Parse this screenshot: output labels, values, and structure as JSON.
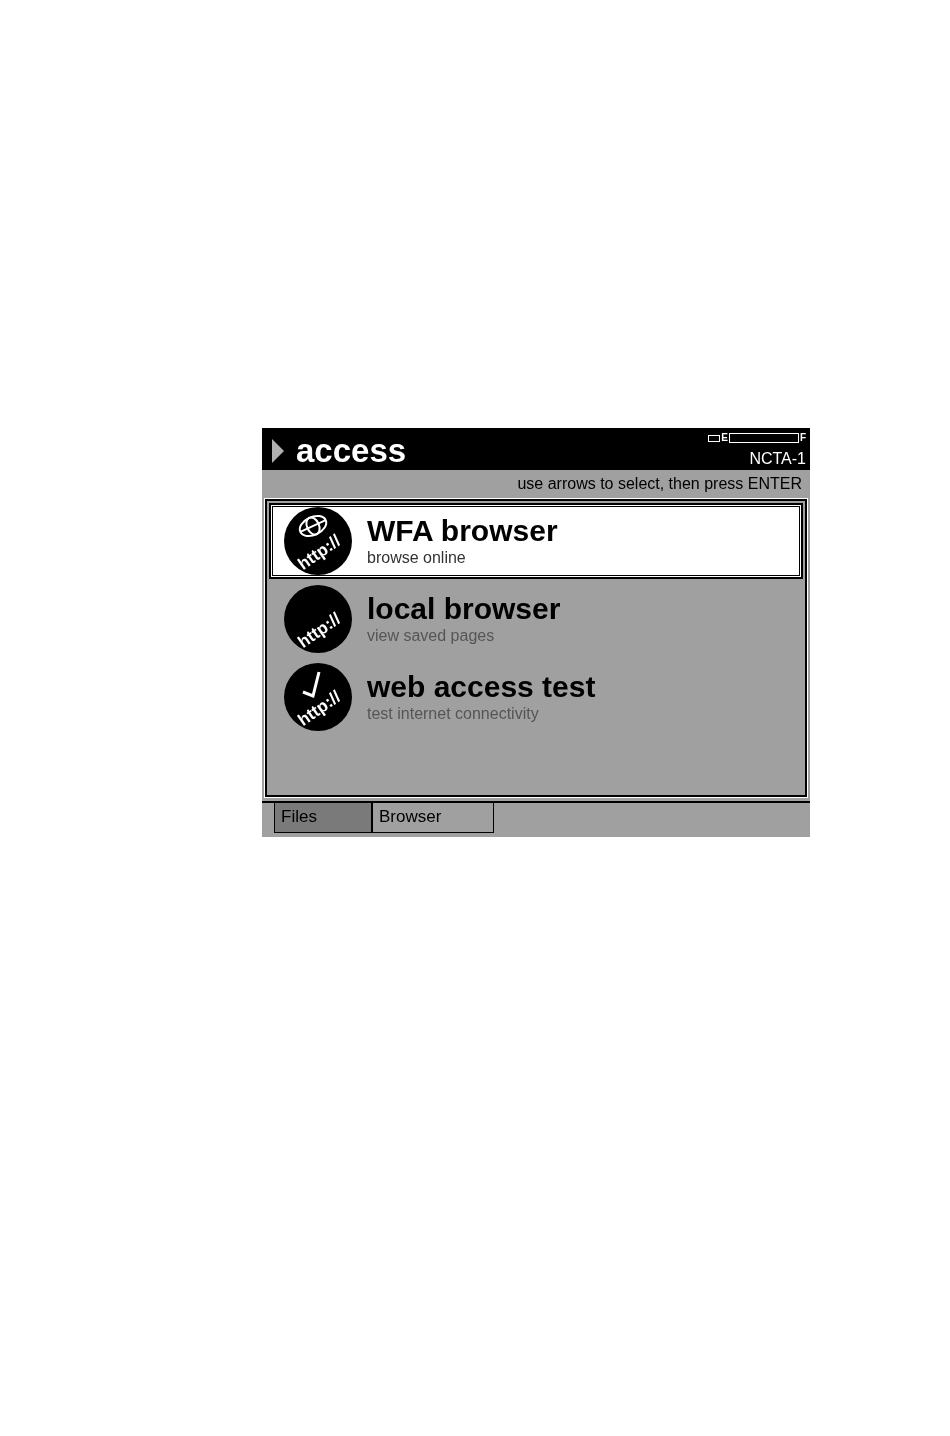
{
  "header": {
    "title": "access",
    "battery": {
      "empty_label": "E",
      "full_label": "F"
    },
    "device": "NCTA-1"
  },
  "hint": "use arrows to select, then press ENTER",
  "items": [
    {
      "title": "WFA browser",
      "subtitle": "browse online",
      "kind": "globe",
      "icon_text": "http://",
      "selected": true
    },
    {
      "title": "local browser",
      "subtitle": "view saved pages",
      "kind": "plain",
      "icon_text": "http://",
      "selected": false
    },
    {
      "title": "web access test",
      "subtitle": "test internet connectivity",
      "kind": "check",
      "icon_text": "http://",
      "selected": false
    }
  ],
  "tabs": [
    {
      "label": "Files",
      "selected": false
    },
    {
      "label": "Browser",
      "selected": true
    }
  ]
}
